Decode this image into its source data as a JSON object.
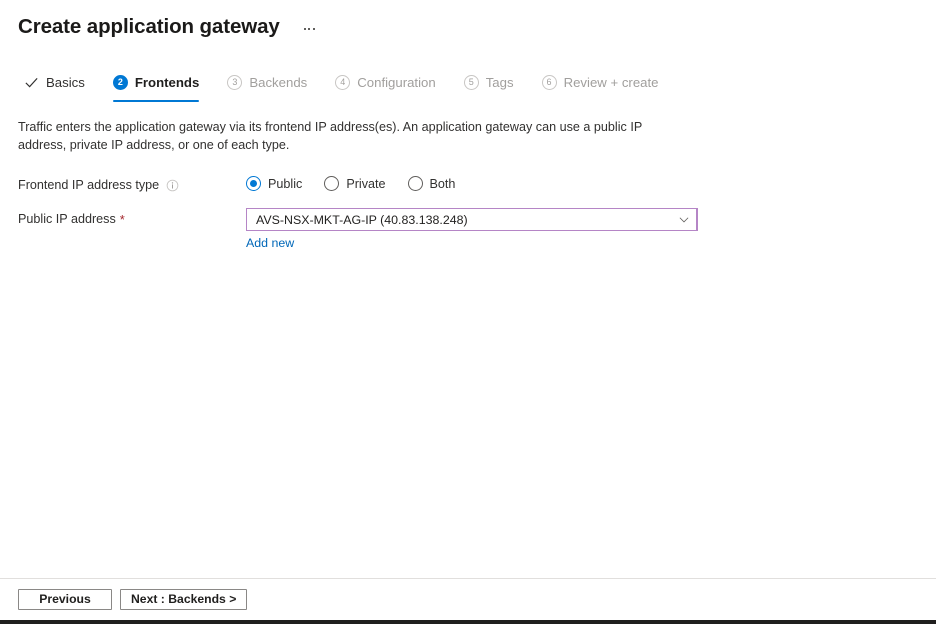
{
  "header": {
    "title": "Create application gateway",
    "more_menu": "…"
  },
  "wizard": {
    "tabs": [
      {
        "label": "Basics",
        "marker": "check",
        "state": "done"
      },
      {
        "label": "Frontends",
        "marker": "2",
        "state": "active"
      },
      {
        "label": "Backends",
        "marker": "3",
        "state": "upcoming"
      },
      {
        "label": "Configuration",
        "marker": "4",
        "state": "upcoming"
      },
      {
        "label": "Tags",
        "marker": "5",
        "state": "upcoming"
      },
      {
        "label": "Review + create",
        "marker": "6",
        "state": "upcoming"
      }
    ]
  },
  "main": {
    "description": "Traffic enters the application gateway via its frontend IP address(es). An application gateway can use a public IP address, private IP address, or one of each type.",
    "frontend_ip_type": {
      "label": "Frontend IP address type",
      "selected": "Public",
      "options": [
        "Public",
        "Private",
        "Both"
      ]
    },
    "public_ip": {
      "label": "Public IP address",
      "required_marker": "*",
      "value": "AVS-NSX-MKT-AG-IP (40.83.138.248)",
      "add_new_label": "Add new"
    }
  },
  "footer": {
    "previous_label": "Previous",
    "next_label": "Next : Backends >"
  },
  "colors": {
    "accent_blue": "#0078d4",
    "link_blue": "#0067b8",
    "required_red": "#a4262c",
    "focus_purple": "#b585c6",
    "muted_grey": "#a19f9d"
  }
}
